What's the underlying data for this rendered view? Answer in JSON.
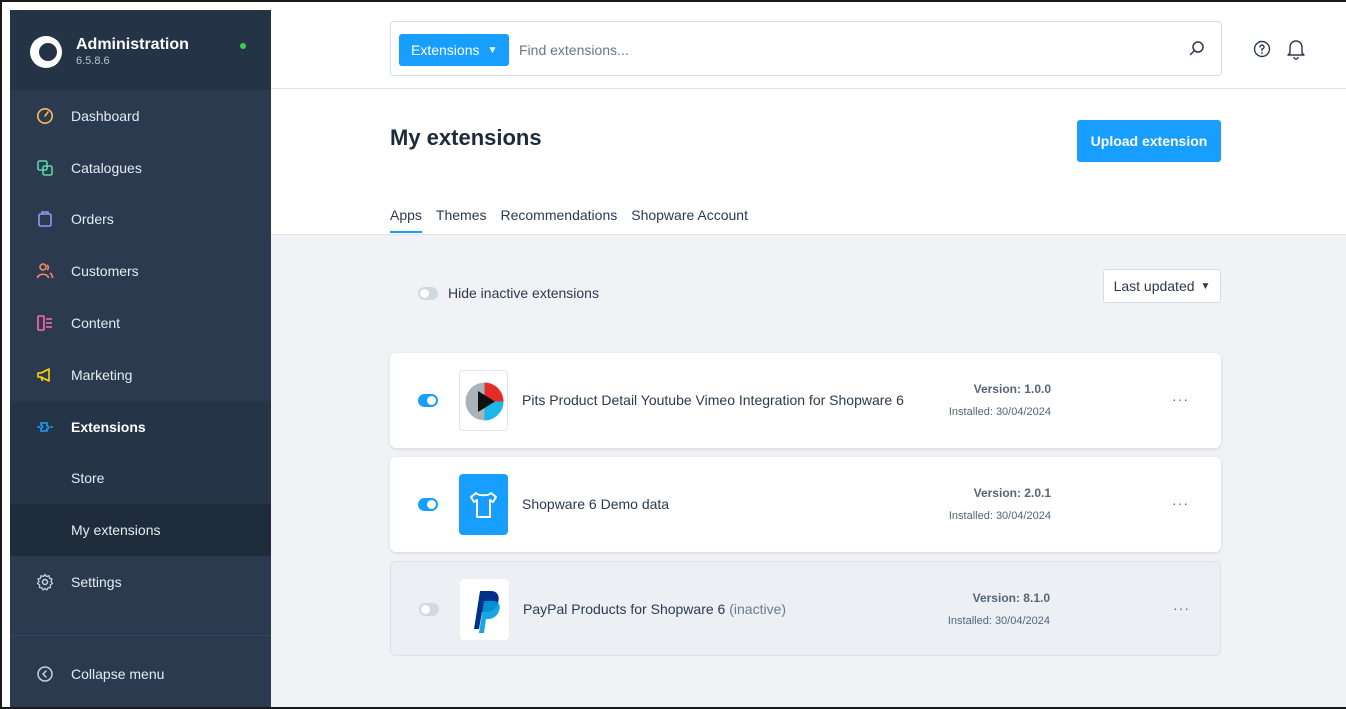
{
  "sidebar": {
    "brand": {
      "title": "Administration",
      "version": "6.5.8.6"
    },
    "items": [
      {
        "label": "Dashboard",
        "icon": "dashboard-icon"
      },
      {
        "label": "Catalogues",
        "icon": "catalogues-icon"
      },
      {
        "label": "Orders",
        "icon": "orders-icon"
      },
      {
        "label": "Customers",
        "icon": "customers-icon"
      },
      {
        "label": "Content",
        "icon": "content-icon"
      },
      {
        "label": "Marketing",
        "icon": "marketing-icon"
      },
      {
        "label": "Extensions",
        "icon": "extensions-icon"
      },
      {
        "label": "Settings",
        "icon": "settings-icon"
      }
    ],
    "sub_items": [
      {
        "label": "Store"
      },
      {
        "label": "My extensions"
      }
    ],
    "collapse_label": "Collapse menu",
    "colors": {
      "bg": "#2b3a4f",
      "icon_accent": "#ffb75d",
      "status": "#37d046"
    }
  },
  "search": {
    "type_label": "Extensions",
    "placeholder": "Find extensions..."
  },
  "header": {
    "title": "My extensions",
    "upload_label": "Upload extension",
    "tabs": [
      {
        "label": "Apps"
      },
      {
        "label": "Themes"
      },
      {
        "label": "Recommendations"
      },
      {
        "label": "Shopware Account"
      }
    ]
  },
  "filters": {
    "hide_inactive_label": "Hide inactive extensions",
    "sort_label": "Last updated"
  },
  "extensions": [
    {
      "name": "Pits Product Detail Youtube Vimeo Integration for Shopware 6",
      "status": "",
      "version": "Version: 1.0.0",
      "installed": "Installed: 30/04/2024",
      "active": true,
      "more_label": "···"
    },
    {
      "name": "Shopware 6 Demo data",
      "status": "",
      "version": "Version: 2.0.1",
      "installed": "Installed: 30/04/2024",
      "active": true,
      "more_label": "···"
    },
    {
      "name": "PayPal Products for Shopware 6",
      "status": "(inactive)",
      "version": "Version: 8.1.0",
      "installed": "Installed: 30/04/2024",
      "active": false,
      "more_label": "···"
    }
  ],
  "colors": {
    "primary": "#189eff",
    "text": "#1c2a3a",
    "content_bg": "#f0f2f5"
  }
}
